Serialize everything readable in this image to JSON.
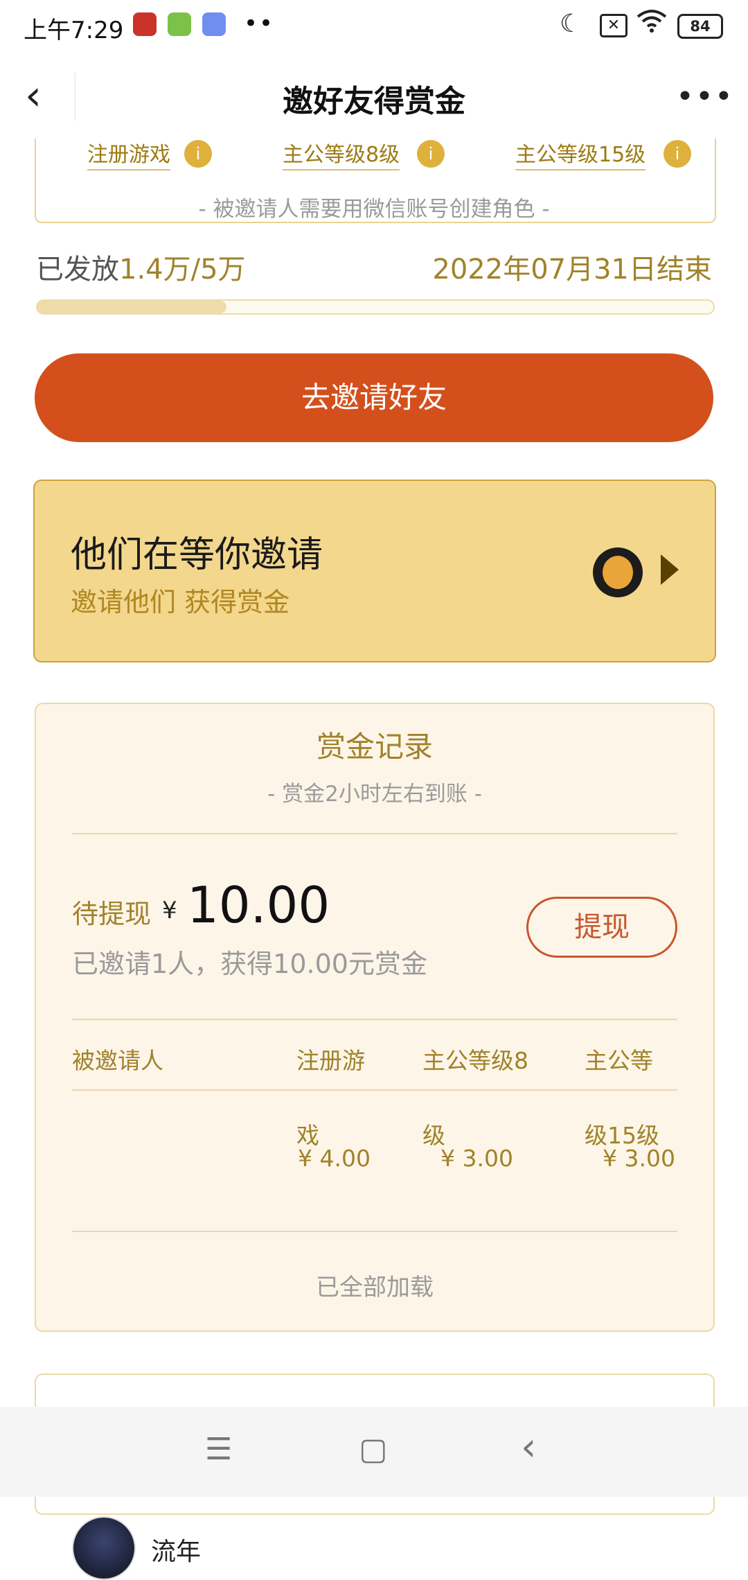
{
  "status_bar": {
    "time": "上午7:29",
    "dots": "••",
    "battery": "84"
  },
  "nav": {
    "back_icon": "‹",
    "title": "邀好友得赏金",
    "more_icon": "•••"
  },
  "levels": {
    "items": [
      "注册游戏",
      "主公等级8级",
      "主公等级15级"
    ],
    "info_icon": "i",
    "note": "- 被邀请人需要用微信账号创建角色 -"
  },
  "progress": {
    "issued_prefix": "已发放",
    "issued_value": "1.4万/5万",
    "end_date": "2022年07月31日结束",
    "fraction": 0.28
  },
  "invite_button": "去邀请好友",
  "waiting": {
    "title": "他们在等你邀请",
    "subtitle": "邀请他们 获得赏金"
  },
  "records": {
    "title": "赏金记录",
    "subtitle": "- 赏金2小时左右到账 -",
    "pending_label": "待提现",
    "currency": "¥",
    "pending_amount": "10.00",
    "pending_sub": "已邀请1人，获得10.00元赏金",
    "withdraw_label": "提现",
    "headers": [
      "被邀请人",
      "注册游",
      "主公等级8",
      "主公等"
    ],
    "row": {
      "name": "流年",
      "c1_tail": "戏",
      "c2_tail": "级",
      "c3_tail": "级15级",
      "v1": "¥ 4.00",
      "v2": "¥ 3.00",
      "v3": "¥ 3.00"
    },
    "loaded": "已全部加载"
  },
  "system_nav": {
    "menu": "☰",
    "home": "▢",
    "back": "‹"
  },
  "colors": {
    "accent": "#d3501d",
    "gold_text": "#a0822a",
    "card_yellow": "#f2d78d",
    "record_bg": "#fdf5e8"
  }
}
